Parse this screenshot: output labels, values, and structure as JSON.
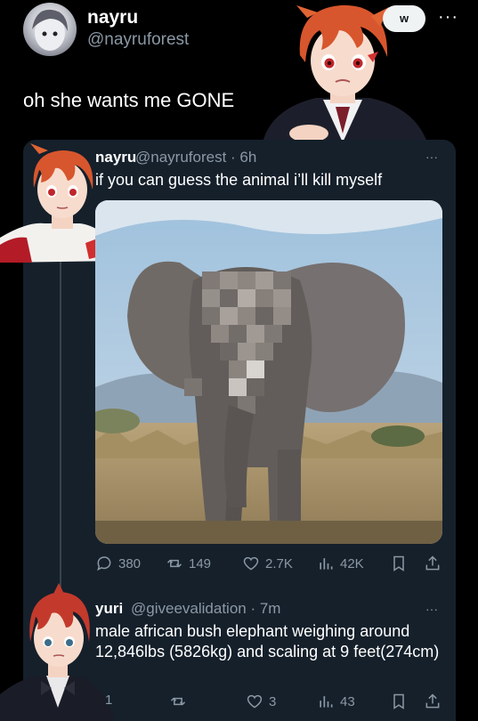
{
  "outer_tweet": {
    "display_name": "nayru",
    "handle": "@nayruforest",
    "text": "oh she wants me GONE",
    "follow_label": "w",
    "more_glyph": "···"
  },
  "quoted_tweet": {
    "display_name": "nayru",
    "handle_time": "@nayruforest · 6h",
    "text": "if you can guess the animal i’ll kill myself",
    "more_glyph": "···",
    "stats": {
      "replies": "380",
      "retweets": "149",
      "likes": "2.7K",
      "views": "42K"
    }
  },
  "reply_tweet": {
    "display_name": "yuri",
    "handle_time": "@giveevalidation · 7m",
    "text": "male african bush elephant weighing around 12,846lbs (5826kg) and scaling at 9 feet(274cm)",
    "more_glyph": "···",
    "stats": {
      "replies": "1",
      "retweets": "",
      "likes": "3",
      "views": "43"
    }
  },
  "colors": {
    "background": "#000000",
    "panel": "#15202b",
    "muted": "#8b98a5",
    "text": "#e7e9ea"
  },
  "icons": [
    "reply-icon",
    "retweet-icon",
    "like-icon",
    "views-icon",
    "bookmark-icon",
    "share-icon"
  ]
}
